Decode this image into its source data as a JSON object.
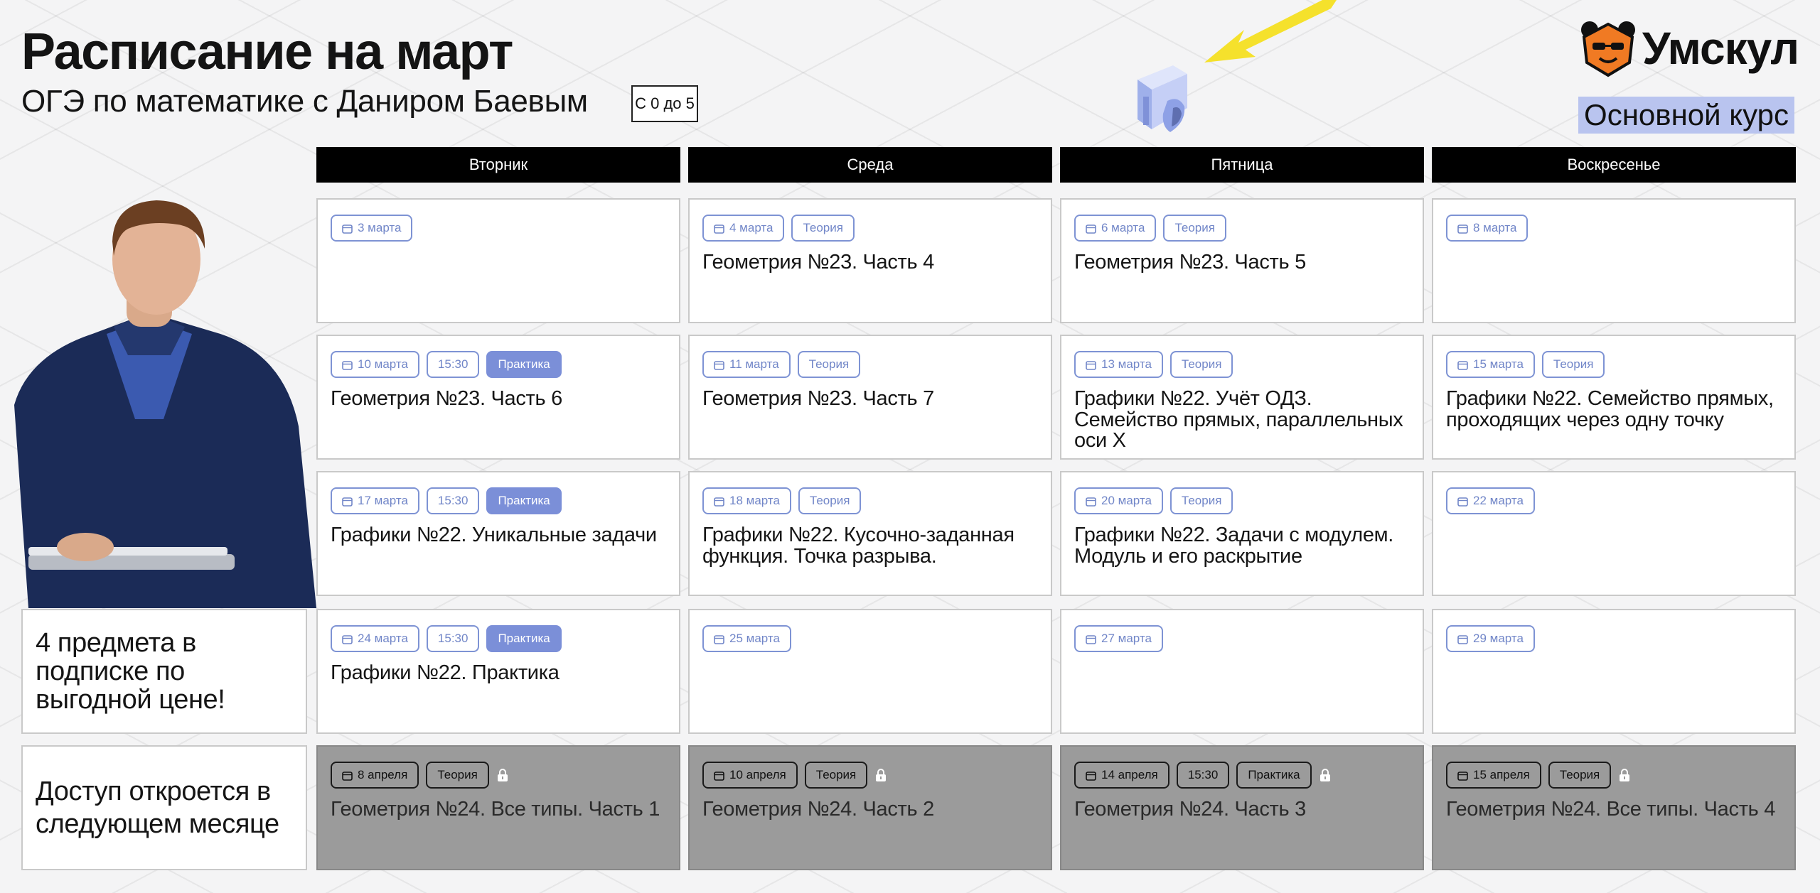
{
  "header": {
    "title": "Расписание на март",
    "subtitle": "ОГЭ по математике с Даниром Баевым",
    "grade_badge": "С 0 до 5",
    "logo_text": "Умскул",
    "course_label": "Основной курс"
  },
  "days": [
    "Вторник",
    "Среда",
    "Пятница",
    "Воскресенье"
  ],
  "side": {
    "promo": "4 предмета в подписке по выгодной цене!",
    "access": "Доступ откроется в следующем месяце"
  },
  "schedule": [
    [
      {
        "date": "3 марта",
        "time": "",
        "type": "",
        "title": ""
      },
      {
        "date": "4 марта",
        "time": "",
        "type": "Теория",
        "title": "Геометрия №23. Часть 4"
      },
      {
        "date": "6 марта",
        "time": "",
        "type": "Теория",
        "title": "Геометрия №23. Часть 5"
      },
      {
        "date": "8 марта",
        "time": "",
        "type": "",
        "title": ""
      }
    ],
    [
      {
        "date": "10 марта",
        "time": "15:30",
        "type": "Практика",
        "title": "Геометрия №23. Часть 6"
      },
      {
        "date": "11 марта",
        "time": "",
        "type": "Теория",
        "title": "Геометрия №23. Часть 7"
      },
      {
        "date": "13 марта",
        "time": "",
        "type": "Теория",
        "title": "Графики №22. Учёт ОДЗ. Семейство прямых, параллельных оси X"
      },
      {
        "date": "15 марта",
        "time": "",
        "type": "Теория",
        "title": "Графики №22. Семейство прямых, проходящих через одну точку"
      }
    ],
    [
      {
        "date": "17 марта",
        "time": "15:30",
        "type": "Практика",
        "title": "Графики №22. Уникальные задачи"
      },
      {
        "date": "18 марта",
        "time": "",
        "type": "Теория",
        "title": "Графики №22. Кусочно-заданная функция. Точка разрыва."
      },
      {
        "date": "20 марта",
        "time": "",
        "type": "Теория",
        "title": "Графики №22. Задачи с модулем. Модуль и его раскрытие"
      },
      {
        "date": "22 марта",
        "time": "",
        "type": "",
        "title": ""
      }
    ],
    [
      {
        "date": "24 марта",
        "time": "15:30",
        "type": "Практика",
        "title": "Графики №22. Практика"
      },
      {
        "date": "25 марта",
        "time": "",
        "type": "",
        "title": ""
      },
      {
        "date": "27 марта",
        "time": "",
        "type": "",
        "title": ""
      },
      {
        "date": "29 марта",
        "time": "",
        "type": "",
        "title": ""
      }
    ],
    [
      {
        "date": "8 апреля",
        "time": "",
        "type": "Теория",
        "title": "Геометрия №24. Все типы. Часть 1",
        "locked": true
      },
      {
        "date": "10 апреля",
        "time": "",
        "type": "Теория",
        "title": "Геометрия №24. Часть 2",
        "locked": true
      },
      {
        "date": "14 апреля",
        "time": "15:30",
        "type": "Практика",
        "title": "Геометрия №24. Часть 3",
        "locked": true
      },
      {
        "date": "15 апреля",
        "time": "",
        "type": "Теория",
        "title": "Геометрия №24. Все типы. Часть 4",
        "locked": true
      }
    ]
  ],
  "colors": {
    "accent": "#7b8fd8",
    "tag_border": "#7e93d4",
    "header_bg": "#000000",
    "locked_bg": "#9b9b9b",
    "logo_orange": "#f07a23",
    "arrow_yellow": "#f5e12c"
  },
  "icons": {
    "date": "calendar-icon",
    "locked": "lock-icon",
    "logo": "bear-logo-icon"
  }
}
